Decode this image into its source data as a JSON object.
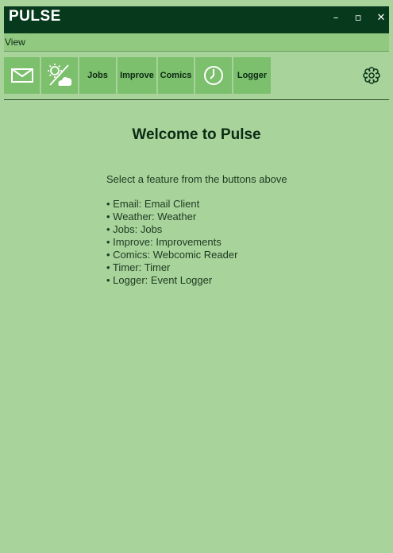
{
  "window": {
    "title": "PULSE",
    "controls": {
      "minimize": "–",
      "maximize": "▫",
      "close": "✕"
    }
  },
  "menu": {
    "items": [
      "View"
    ]
  },
  "toolbar": {
    "buttons": [
      {
        "label": "",
        "icon": "mail-icon"
      },
      {
        "label": "",
        "icon": "weather-icon"
      },
      {
        "label": "Jobs"
      },
      {
        "label": "Improve"
      },
      {
        "label": "Comics"
      },
      {
        "label": "",
        "icon": "clock-icon"
      },
      {
        "label": "Logger"
      }
    ],
    "settings_icon": "gear-icon"
  },
  "main": {
    "heading": "Welcome to Pulse",
    "subtitle": "Select a feature from the buttons above",
    "features": [
      "• Email: Email Client",
      "• Weather: Weather",
      "• Jobs: Jobs",
      "• Improve: Improvements",
      "• Comics: Webcomic Reader",
      "• Timer: Timer",
      "• Logger: Event Logger"
    ]
  },
  "colors": {
    "background": "#a8d39a",
    "titlebar": "#073a1d",
    "menubar": "#92c981",
    "button": "#7cbf6d",
    "text": "#0c2a14"
  }
}
